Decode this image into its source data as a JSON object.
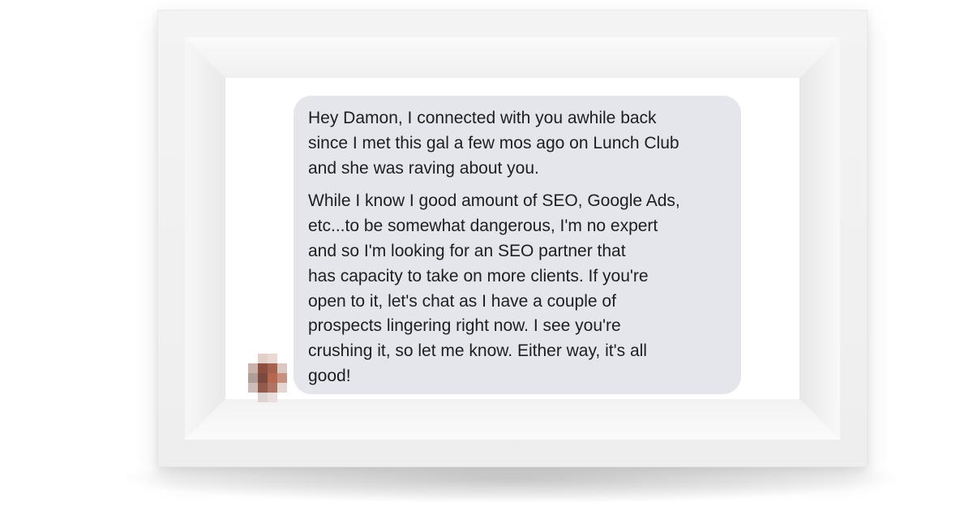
{
  "message": {
    "paragraphs": [
      "Hey Damon, I connected with you awhile back\nsince I met this gal a few mos ago on Lunch Club\nand she was raving about you.",
      "While I know I good amount of SEO, Google Ads,\netc...to be somewhat dangerous, I'm no expert\nand so I'm looking for an SEO partner that\nhas capacity to take on more clients. If you're\nopen to it, let's chat as I have a couple of\nprospects lingering right now. I see you're\ncrushing it, so let me know. Either way, it's all\ngood!"
    ]
  },
  "colors": {
    "bubble_background": "#e4e6eb",
    "text": "#1c1e21",
    "frame": "#f1f1f1",
    "mat": "#ffffff"
  },
  "avatar": {
    "style": "pixelated",
    "icon": "avatar-blurred"
  }
}
